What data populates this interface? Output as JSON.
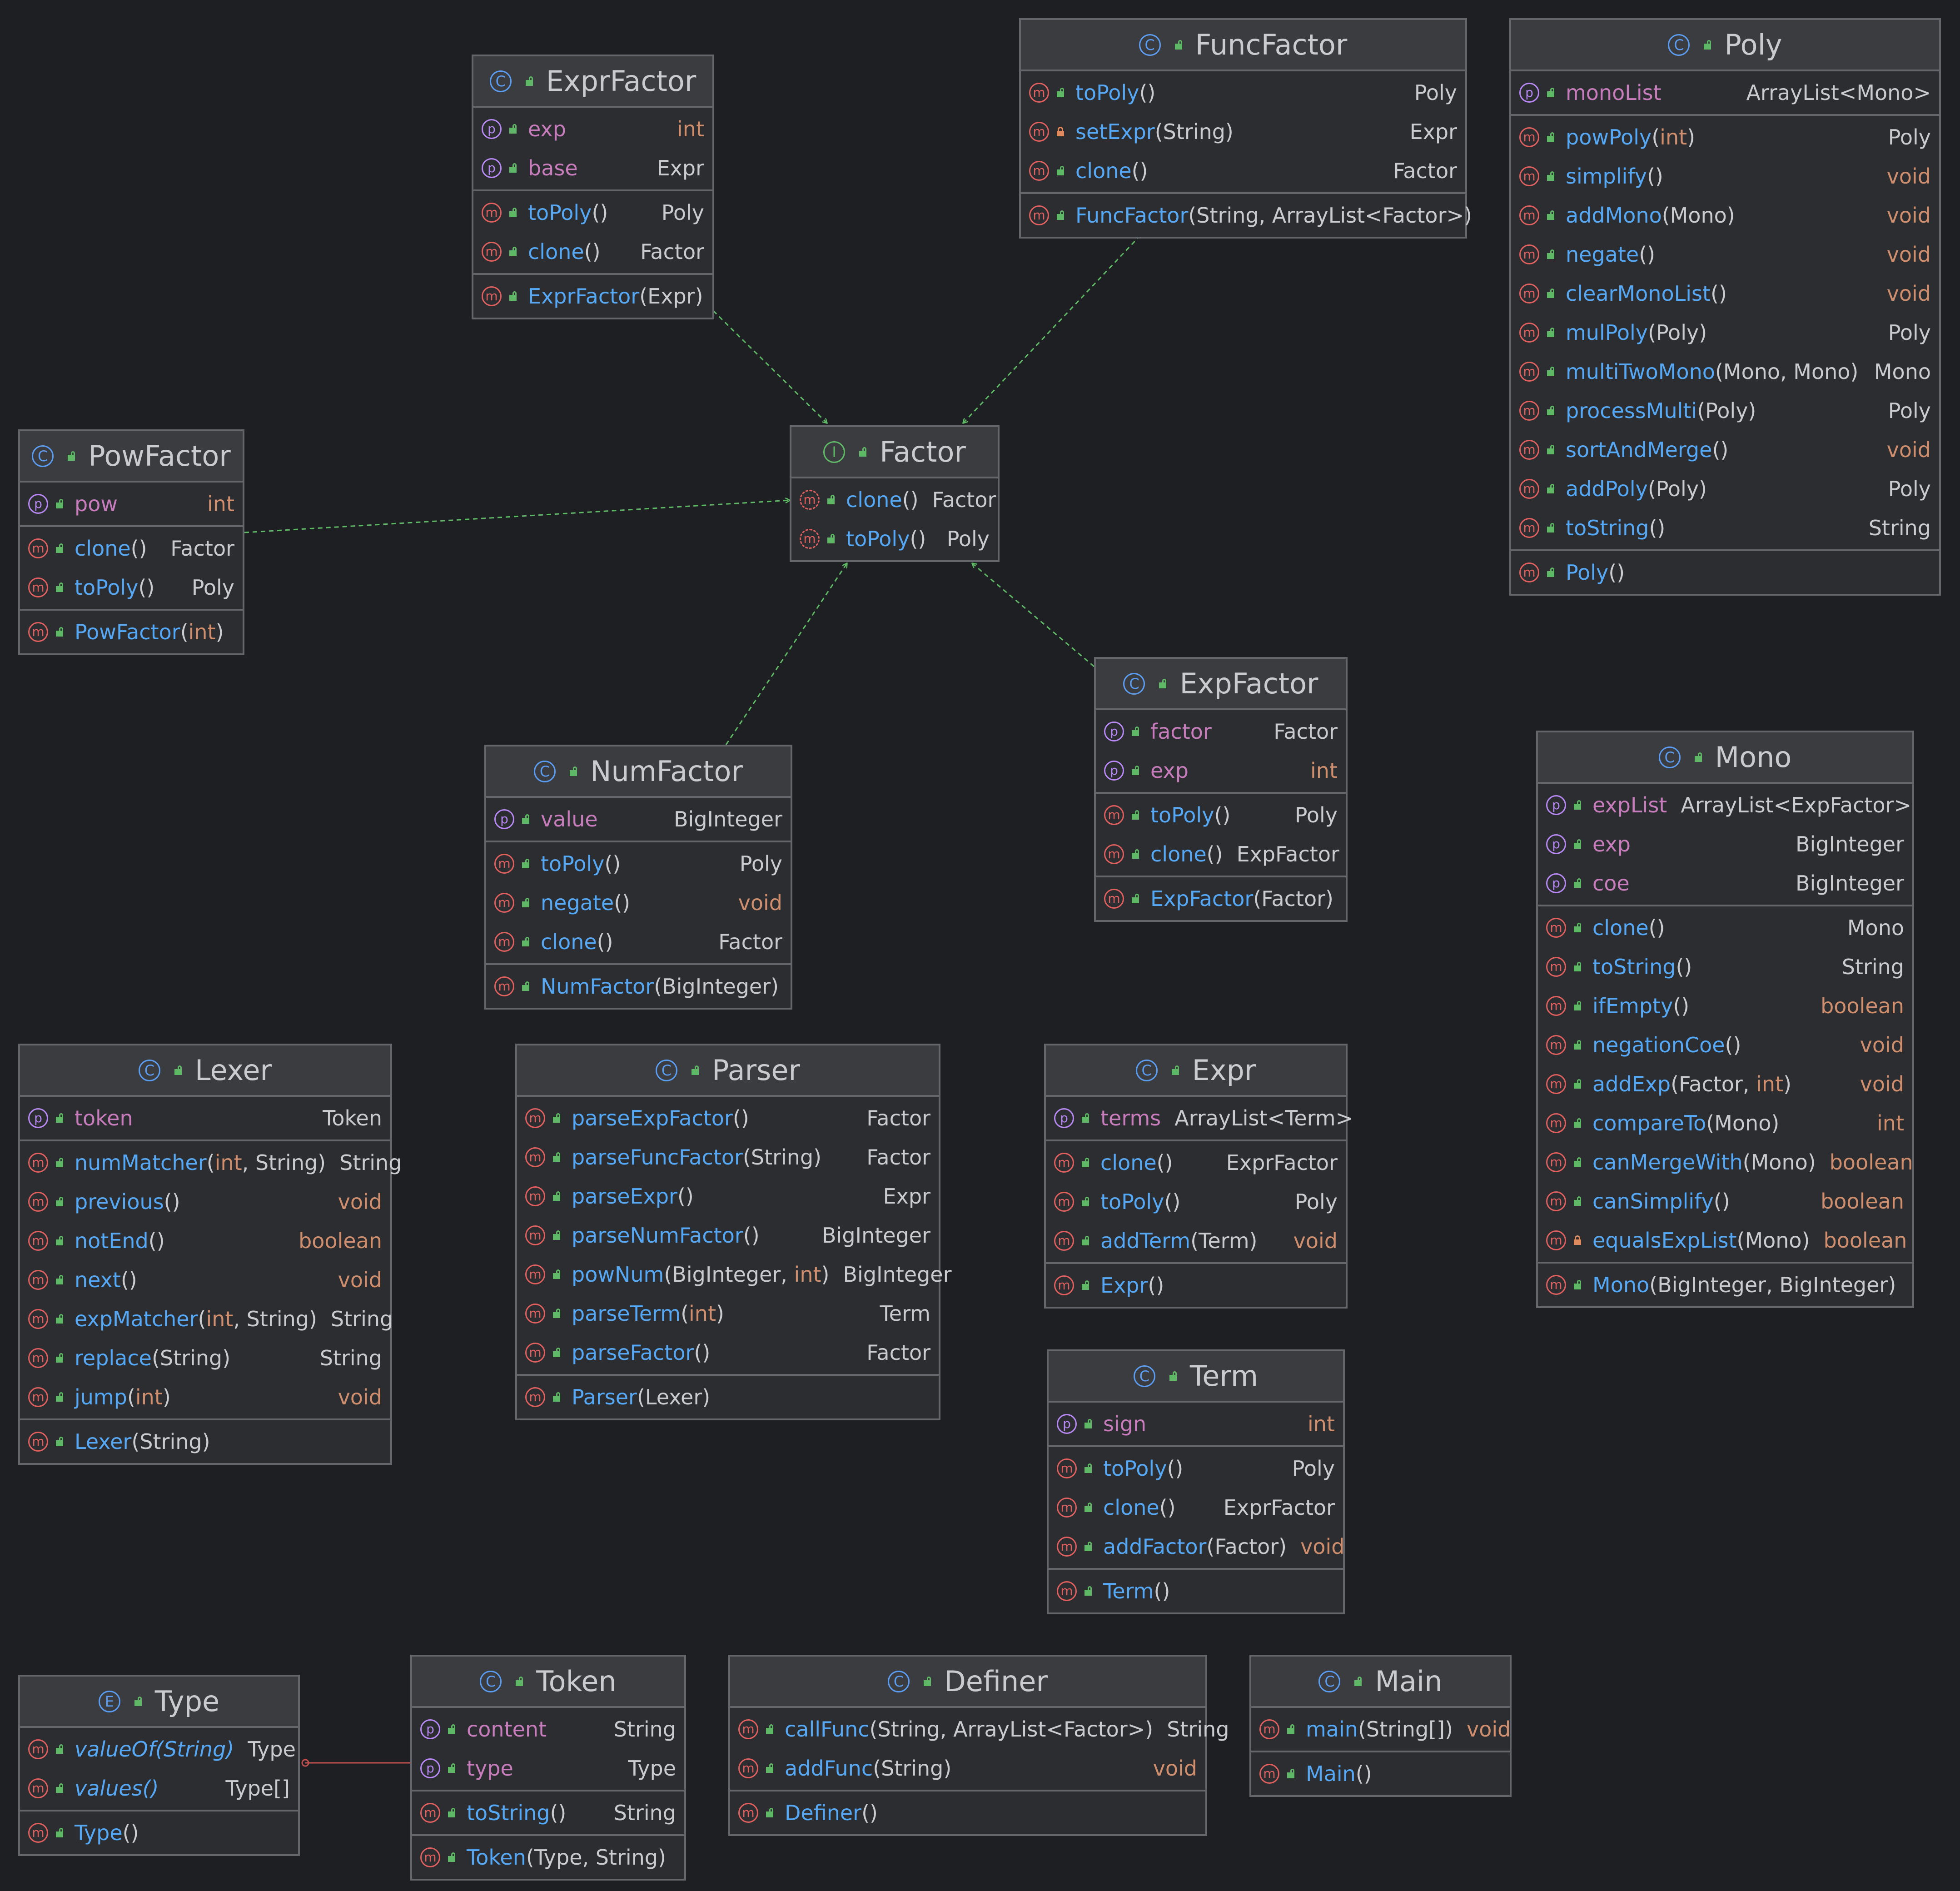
{
  "colors": {
    "background": "#1e1f22",
    "box": "#2b2d30",
    "border": "#64666b",
    "method_name": "#56a8f5",
    "property_name": "#c77dbb",
    "keyword_type": "#cf8e6d",
    "text": "#c9cbcf",
    "inheritance_line": "#5fb865",
    "association_line": "#c0504d"
  },
  "classes": [
    {
      "id": "ExprFactor",
      "kind": "class",
      "name": "ExprFactor",
      "fields": [
        {
          "name": "exp",
          "type": "int",
          "kw": true
        },
        {
          "name": "base",
          "type": "Expr",
          "kw": false
        }
      ],
      "methods": [
        {
          "name": "toPoly",
          "params": "()",
          "ret": "Poly"
        },
        {
          "name": "clone",
          "params": "()",
          "ret": "Factor"
        }
      ],
      "constructors": [
        {
          "name": "ExprFactor",
          "params": "(Expr)"
        }
      ]
    },
    {
      "id": "FuncFactor",
      "kind": "class",
      "name": "FuncFactor",
      "fields": [],
      "methods": [
        {
          "name": "toPoly",
          "params": "()",
          "ret": "Poly"
        },
        {
          "name": "setExpr",
          "params": "(String)",
          "ret": "Expr",
          "private": true
        },
        {
          "name": "clone",
          "params": "()",
          "ret": "Factor"
        }
      ],
      "constructors": [
        {
          "name": "FuncFactor",
          "params": "(String, ArrayList<Factor>)"
        }
      ]
    },
    {
      "id": "Poly",
      "kind": "class",
      "name": "Poly",
      "fields": [
        {
          "name": "monoList",
          "type": "ArrayList<Mono>",
          "kw": false
        }
      ],
      "methods": [
        {
          "name": "powPoly",
          "params": "(int)",
          "ret": "Poly"
        },
        {
          "name": "simplify",
          "params": "()",
          "ret": "void"
        },
        {
          "name": "addMono",
          "params": "(Mono)",
          "ret": "void"
        },
        {
          "name": "negate",
          "params": "()",
          "ret": "void"
        },
        {
          "name": "clearMonoList",
          "params": "()",
          "ret": "void"
        },
        {
          "name": "mulPoly",
          "params": "(Poly)",
          "ret": "Poly"
        },
        {
          "name": "multiTwoMono",
          "params": "(Mono, Mono)",
          "ret": "Mono"
        },
        {
          "name": "processMulti",
          "params": "(Poly)",
          "ret": "Poly"
        },
        {
          "name": "sortAndMerge",
          "params": "()",
          "ret": "void"
        },
        {
          "name": "addPoly",
          "params": "(Poly)",
          "ret": "Poly"
        },
        {
          "name": "toString",
          "params": "()",
          "ret": "String"
        }
      ],
      "constructors": [
        {
          "name": "Poly",
          "params": "()"
        }
      ]
    },
    {
      "id": "PowFactor",
      "kind": "class",
      "name": "PowFactor",
      "fields": [
        {
          "name": "pow",
          "type": "int",
          "kw": true
        }
      ],
      "methods": [
        {
          "name": "clone",
          "params": "()",
          "ret": "Factor"
        },
        {
          "name": "toPoly",
          "params": "()",
          "ret": "Poly"
        }
      ],
      "constructors": [
        {
          "name": "PowFactor",
          "params": "(int)"
        }
      ]
    },
    {
      "id": "Factor",
      "kind": "interface",
      "name": "Factor",
      "fields": [],
      "methods": [
        {
          "name": "clone",
          "params": "()",
          "ret": "Factor",
          "abstract": true
        },
        {
          "name": "toPoly",
          "params": "()",
          "ret": "Poly",
          "abstract": true
        }
      ],
      "constructors": []
    },
    {
      "id": "ExpFactor",
      "kind": "class",
      "name": "ExpFactor",
      "fields": [
        {
          "name": "factor",
          "type": "Factor",
          "kw": false
        },
        {
          "name": "exp",
          "type": "int",
          "kw": true
        }
      ],
      "methods": [
        {
          "name": "toPoly",
          "params": "()",
          "ret": "Poly"
        },
        {
          "name": "clone",
          "params": "()",
          "ret": "ExpFactor"
        }
      ],
      "constructors": [
        {
          "name": "ExpFactor",
          "params": "(Factor)"
        }
      ]
    },
    {
      "id": "NumFactor",
      "kind": "class",
      "name": "NumFactor",
      "fields": [
        {
          "name": "value",
          "type": "BigInteger",
          "kw": false
        }
      ],
      "methods": [
        {
          "name": "toPoly",
          "params": "()",
          "ret": "Poly"
        },
        {
          "name": "negate",
          "params": "()",
          "ret": "void"
        },
        {
          "name": "clone",
          "params": "()",
          "ret": "Factor"
        }
      ],
      "constructors": [
        {
          "name": "NumFactor",
          "params": "(BigInteger)"
        }
      ]
    },
    {
      "id": "Mono",
      "kind": "class",
      "name": "Mono",
      "fields": [
        {
          "name": "expList",
          "type": "ArrayList<ExpFactor>",
          "kw": false
        },
        {
          "name": "exp",
          "type": "BigInteger",
          "kw": false
        },
        {
          "name": "coe",
          "type": "BigInteger",
          "kw": false
        }
      ],
      "methods": [
        {
          "name": "clone",
          "params": "()",
          "ret": "Mono"
        },
        {
          "name": "toString",
          "params": "()",
          "ret": "String"
        },
        {
          "name": "ifEmpty",
          "params": "()",
          "ret": "boolean"
        },
        {
          "name": "negationCoe",
          "params": "()",
          "ret": "void"
        },
        {
          "name": "addExp",
          "params": "(Factor, int)",
          "ret": "void"
        },
        {
          "name": "compareTo",
          "params": "(Mono)",
          "ret": "int"
        },
        {
          "name": "canMergeWith",
          "params": "(Mono)",
          "ret": "boolean"
        },
        {
          "name": "canSimplify",
          "params": "()",
          "ret": "boolean"
        },
        {
          "name": "equalsExpList",
          "params": "(Mono)",
          "ret": "boolean",
          "private": true
        }
      ],
      "constructors": [
        {
          "name": "Mono",
          "params": "(BigInteger, BigInteger)"
        }
      ]
    },
    {
      "id": "Lexer",
      "kind": "class",
      "name": "Lexer",
      "fields": [
        {
          "name": "token",
          "type": "Token",
          "kw": false
        }
      ],
      "methods": [
        {
          "name": "numMatcher",
          "params": "(int, String)",
          "ret": "String"
        },
        {
          "name": "previous",
          "params": "()",
          "ret": "void"
        },
        {
          "name": "notEnd",
          "params": "()",
          "ret": "boolean"
        },
        {
          "name": "next",
          "params": "()",
          "ret": "void"
        },
        {
          "name": "expMatcher",
          "params": "(int, String)",
          "ret": "String"
        },
        {
          "name": "replace",
          "params": "(String)",
          "ret": "String"
        },
        {
          "name": "jump",
          "params": "(int)",
          "ret": "void"
        }
      ],
      "constructors": [
        {
          "name": "Lexer",
          "params": "(String)"
        }
      ]
    },
    {
      "id": "Parser",
      "kind": "class",
      "name": "Parser",
      "fields": [],
      "methods": [
        {
          "name": "parseExpFactor",
          "params": "()",
          "ret": "Factor"
        },
        {
          "name": "parseFuncFactor",
          "params": "(String)",
          "ret": "Factor"
        },
        {
          "name": "parseExpr",
          "params": "()",
          "ret": "Expr"
        },
        {
          "name": "parseNumFactor",
          "params": "()",
          "ret": "BigInteger"
        },
        {
          "name": "powNum",
          "params": "(BigInteger, int)",
          "ret": "BigInteger"
        },
        {
          "name": "parseTerm",
          "params": "(int)",
          "ret": "Term"
        },
        {
          "name": "parseFactor",
          "params": "()",
          "ret": "Factor"
        }
      ],
      "constructors": [
        {
          "name": "Parser",
          "params": "(Lexer)"
        }
      ]
    },
    {
      "id": "Expr",
      "kind": "class",
      "name": "Expr",
      "fields": [
        {
          "name": "terms",
          "type": "ArrayList<Term>",
          "kw": false
        }
      ],
      "methods": [
        {
          "name": "clone",
          "params": "()",
          "ret": "ExprFactor"
        },
        {
          "name": "toPoly",
          "params": "()",
          "ret": "Poly"
        },
        {
          "name": "addTerm",
          "params": "(Term)",
          "ret": "void"
        }
      ],
      "constructors": [
        {
          "name": "Expr",
          "params": "()"
        }
      ]
    },
    {
      "id": "Term",
      "kind": "class",
      "name": "Term",
      "fields": [
        {
          "name": "sign",
          "type": "int",
          "kw": true
        }
      ],
      "methods": [
        {
          "name": "toPoly",
          "params": "()",
          "ret": "Poly"
        },
        {
          "name": "clone",
          "params": "()",
          "ret": "ExprFactor"
        },
        {
          "name": "addFactor",
          "params": "(Factor)",
          "ret": "void"
        }
      ],
      "constructors": [
        {
          "name": "Term",
          "params": "()"
        }
      ]
    },
    {
      "id": "Type",
      "kind": "enum",
      "name": "Type",
      "fields": [],
      "methods": [
        {
          "name": "valueOf(String)",
          "params": "",
          "ret": "Type",
          "static": true
        },
        {
          "name": "values()",
          "params": "",
          "ret": "Type[]",
          "static": true
        }
      ],
      "constructors": [
        {
          "name": "Type",
          "params": "()"
        }
      ]
    },
    {
      "id": "Token",
      "kind": "class",
      "name": "Token",
      "fields": [
        {
          "name": "content",
          "type": "String",
          "kw": false
        },
        {
          "name": "type",
          "type": "Type",
          "kw": false
        }
      ],
      "methods": [
        {
          "name": "toString",
          "params": "()",
          "ret": "String"
        }
      ],
      "constructors": [
        {
          "name": "Token",
          "params": "(Type, String)"
        }
      ]
    },
    {
      "id": "Definer",
      "kind": "class",
      "name": "Definer",
      "fields": [],
      "methods": [
        {
          "name": "callFunc",
          "params": "(String, ArrayList<Factor>)",
          "ret": "String"
        },
        {
          "name": "addFunc",
          "params": "(String)",
          "ret": "void"
        }
      ],
      "constructors": [
        {
          "name": "Definer",
          "params": "()"
        }
      ]
    },
    {
      "id": "Main",
      "kind": "class",
      "name": "Main",
      "fields": [],
      "methods": [
        {
          "name": "main",
          "params": "(String[])",
          "ret": "void"
        }
      ],
      "constructors": [
        {
          "name": "Main",
          "params": "()"
        }
      ]
    }
  ],
  "relations": [
    {
      "from": "ExprFactor",
      "to": "Factor",
      "type": "implements"
    },
    {
      "from": "FuncFactor",
      "to": "Factor",
      "type": "implements"
    },
    {
      "from": "PowFactor",
      "to": "Factor",
      "type": "implements"
    },
    {
      "from": "NumFactor",
      "to": "Factor",
      "type": "implements"
    },
    {
      "from": "ExpFactor",
      "to": "Factor",
      "type": "implements"
    },
    {
      "from": "Token",
      "to": "Type",
      "type": "nested"
    }
  ]
}
